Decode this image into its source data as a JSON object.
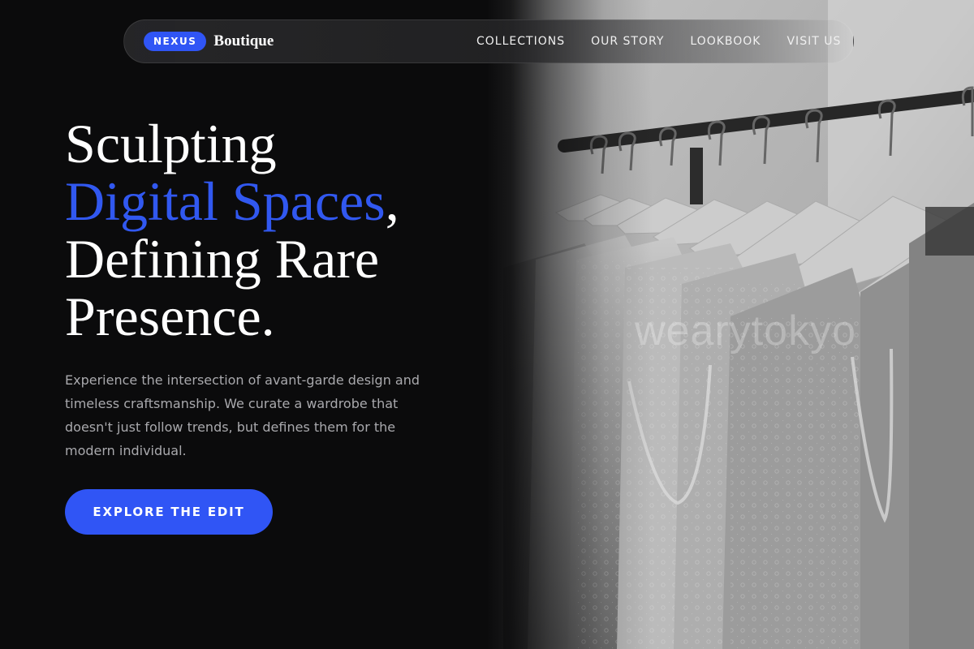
{
  "nav": {
    "badge": "NEXUS",
    "brand": "Boutique",
    "links": [
      {
        "label": "COLLECTIONS"
      },
      {
        "label": "OUR STORY"
      },
      {
        "label": "LOOKBOOK"
      },
      {
        "label": "VISIT US"
      }
    ]
  },
  "hero": {
    "headline": {
      "line1": "Sculpting",
      "accent": "Digital Spaces",
      "accent_punct": ",",
      "line3": "Defining Rare",
      "line4": "Presence."
    },
    "description": "Experience the intersection of avant-garde design and timeless craftsmanship. We curate a wardrobe that doesn't just follow trends, but defines them for the modern individual.",
    "cta_label": "EXPLORE THE EDIT",
    "image_watermark": "wearytokyo"
  },
  "colors": {
    "accent": "#3055f5",
    "background": "#0b0b0c",
    "text_muted": "#a9a9ad"
  }
}
